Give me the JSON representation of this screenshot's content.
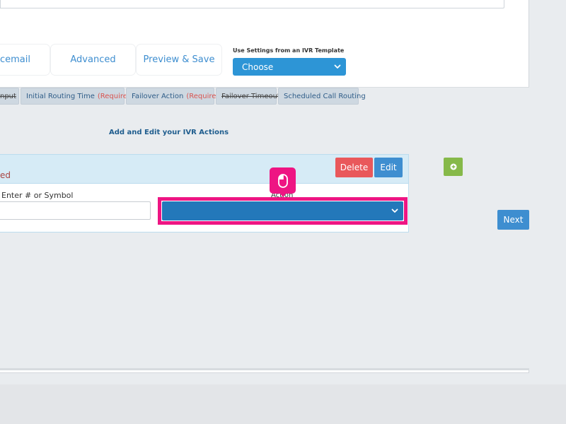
{
  "nav_tabs": [
    {
      "label": "cemail"
    },
    {
      "label": "Advanced"
    },
    {
      "label": "Preview & Save"
    }
  ],
  "template": {
    "label": "Use Settings from an IVR Template",
    "selected": "Choose"
  },
  "sub_tabs": [
    {
      "label": "nput",
      "required": "",
      "strikethrough": true
    },
    {
      "label": "Initial Routing Time",
      "required": "(Required)",
      "strikethrough": false
    },
    {
      "label": "Failover Action",
      "required": "(Required)",
      "strikethrough": false
    },
    {
      "label": "Failover Timeout",
      "required": "",
      "strikethrough": true
    },
    {
      "label": "Scheduled Call Routing",
      "required": "",
      "strikethrough": false
    }
  ],
  "section": {
    "title": "Add and Edit your IVR Actions"
  },
  "action_card": {
    "header_text": "ed",
    "delete_label": "Delete",
    "edit_label": "Edit",
    "symbol_label": "Enter # or Symbol",
    "symbol_value": "",
    "action_label": "Action",
    "action_selected": ""
  },
  "buttons": {
    "next_label": "Next"
  },
  "icons": {
    "cursor": "mouse-icon",
    "add": "plus-circle-icon",
    "chevron": "chevron-down-icon"
  },
  "colors": {
    "primary": "#3e8ed0",
    "danger": "#e9585b",
    "success": "#86b949",
    "highlight": "#ee1583"
  }
}
